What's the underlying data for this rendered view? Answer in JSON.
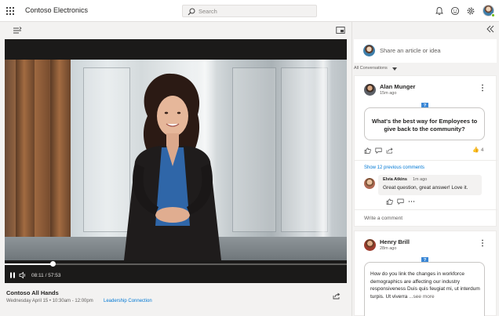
{
  "header": {
    "app_title": "Contoso Electronics",
    "search_placeholder": "Search",
    "icons": [
      "waffle-icon",
      "bell-icon",
      "smiley-icon",
      "gear-icon"
    ]
  },
  "player": {
    "current_time": "08:11",
    "duration": "57:53",
    "progress": 0.141
  },
  "video_info": {
    "title": "Contoso All Hands",
    "date": "Wednesday April 15 • 10:30am - 12:00pm",
    "community_link": "Leadership Connection"
  },
  "sidebar": {
    "composer_placeholder": "Share an article or idea",
    "filter_label": "All Conversations",
    "conversations": [
      {
        "author": "Alan Munger",
        "time": "15m ago",
        "question": "What's the best way for Employees to give back to the community?",
        "like_count": "4",
        "previous_comments_link": "Show 12 previous comments",
        "reply": {
          "author": "Elvia Atkins",
          "time": "1m ago",
          "text": "Great question, great answer! Love it."
        },
        "write_comment_placeholder": "Write a comment"
      },
      {
        "author": "Henry Brill",
        "time": "28m ago",
        "body": "How do you link the changes in workforce demographics are affecting our industry responsiveness Duis quis feugiat mi, ut interdum turpis. Ut viverra ",
        "see_more": "...see more"
      }
    ]
  },
  "colors": {
    "accent": "#0078d4",
    "question_badge": "#3a87d6",
    "like": "#f0a30a",
    "presence": "#6bb700"
  }
}
